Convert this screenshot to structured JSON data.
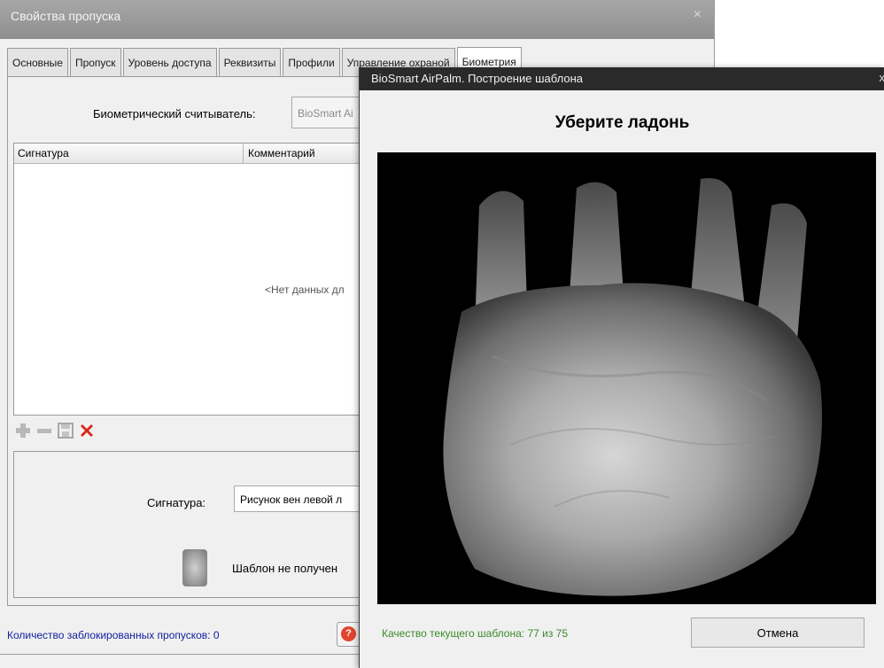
{
  "main_window": {
    "title": "Свойства пропуска",
    "close_glyph": "×",
    "tabs": [
      "Основные",
      "Пропуск",
      "Уровень доступа",
      "Реквизиты",
      "Профили",
      "Управление охраной",
      "Биометрия"
    ],
    "active_tab": "Биометрия",
    "reader_label": "Биометрический считыватель:",
    "reader_value": "BioSmart Ai",
    "grid": {
      "columns": [
        "Сигнатура",
        "Комментарий"
      ],
      "empty_text": "<Нет данных дл"
    },
    "toolbar_icons": [
      "add-icon",
      "remove-icon",
      "save-icon",
      "delete-icon"
    ],
    "signature_label": "Сигнатура:",
    "signature_value": "Рисунок вен левой л",
    "template_status": "Шаблон не получен",
    "blocked_label": "Количество заблокированных пропусков: 0",
    "colors": {
      "link_blue": "#0f1e9e",
      "delete_red": "#d9261c"
    }
  },
  "bio_dialog": {
    "title": "BioSmart AirPalm. Построение шаблона",
    "close_glyph": "x",
    "heading": "Уберите ладонь",
    "quality_text": "Качество текущего шаблона: 77 из 75",
    "cancel_label": "Отмена",
    "colors": {
      "quality_green": "#3a8a2a",
      "titlebar": "#2a2a2a"
    }
  }
}
